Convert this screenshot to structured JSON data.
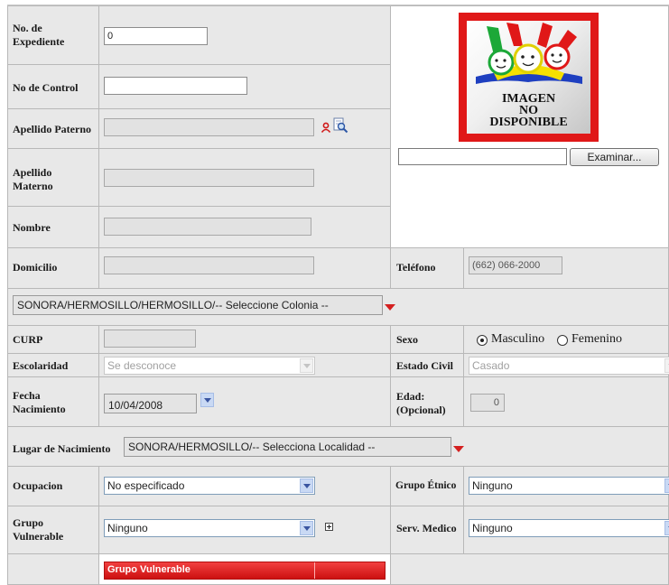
{
  "labels": {
    "expediente": "No. de Expediente",
    "control": "No de Control",
    "apellido_paterno": "Apellido Paterno",
    "apellido_materno": "Apellido Materno",
    "nombre": "Nombre",
    "domicilio": "Domicilio",
    "telefono": "Teléfono",
    "curp": "CURP",
    "sexo": "Sexo",
    "escolaridad": "Escolaridad",
    "estado_civil": "Estado Civil",
    "fecha_nacimiento": "Fecha Nacimiento",
    "edad": "Edad: (Opcional)",
    "lugar_nacimiento": "Lugar de Nacimiento",
    "ocupacion": "Ocupacion",
    "grupo_etnico": "Grupo Étnico",
    "grupo_vulnerable": "Grupo Vulnerable",
    "serv_medico": "Serv. Medico"
  },
  "values": {
    "expediente": "0",
    "control": "",
    "apellido_paterno": "",
    "apellido_materno": "",
    "nombre": "",
    "domicilio": "",
    "telefono": "(662) 066-2000",
    "colonia": "SONORA/HERMOSILLO/HERMOSILLO/-- Seleccione Colonia --",
    "curp": "",
    "escolaridad": "Se desconoce",
    "estado_civil": "Casado",
    "fecha_nacimiento": "10/04/2008",
    "edad": "0",
    "lugar_nacimiento": "SONORA/HERMOSILLO/-- Selecciona Localidad --",
    "ocupacion": "No especificado",
    "grupo_etnico": "Ninguno",
    "grupo_vulnerable": "Ninguno",
    "serv_medico": "Ninguno",
    "photo_path": ""
  },
  "sexo": {
    "options": [
      "Masculino",
      "Femenino"
    ],
    "selected": "Masculino"
  },
  "photo": {
    "line1": "IMAGEN",
    "line2": "NO",
    "line3": "DISPONIBLE",
    "browse_label": "Examinar..."
  },
  "tables": {
    "vulnerable_header": "Grupo Vulnerable"
  },
  "colors": {
    "label_bg": "#e8e8e8",
    "accent_red": "#d42020",
    "border": "#b8b8b8"
  },
  "icons": [
    "person-icon",
    "search-icon",
    "chevron-down-icon",
    "red-triangle-icon",
    "plus-box-icon"
  ]
}
